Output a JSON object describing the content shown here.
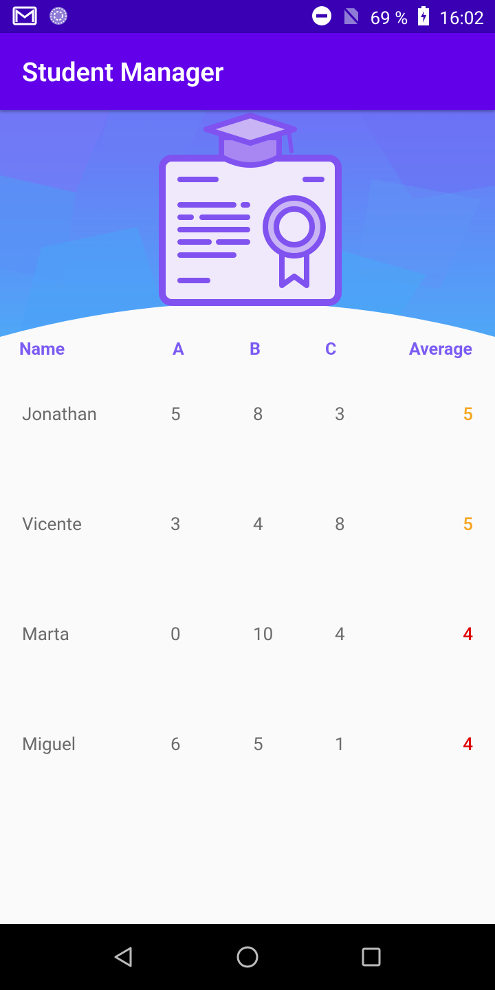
{
  "status_bar": {
    "battery": "69 %",
    "time": "16:02",
    "icons": [
      "gmail-icon",
      "sync-icon",
      "dnd-icon",
      "no-sim-icon",
      "battery-charging-icon"
    ]
  },
  "app_bar": {
    "title": "Student Manager"
  },
  "table": {
    "headers": {
      "name": "Name",
      "a": "A",
      "b": "B",
      "c": "C",
      "average": "Average"
    },
    "rows": [
      {
        "name": "Jonathan",
        "a": "5",
        "b": "8",
        "c": "3",
        "average": "5",
        "average_color": "#f5a623"
      },
      {
        "name": "Vicente",
        "a": "3",
        "b": "4",
        "c": "8",
        "average": "5",
        "average_color": "#f5a623"
      },
      {
        "name": "Marta",
        "a": "0",
        "b": "10",
        "c": "4",
        "average": "4",
        "average_color": "#e00000"
      },
      {
        "name": "Miguel",
        "a": "6",
        "b": "5",
        "c": "1",
        "average": "4",
        "average_color": "#e00000"
      }
    ]
  },
  "colors": {
    "accent": "#6200ea",
    "header_text": "#7c5cf2",
    "status_bar": "#3a00b4"
  },
  "nav_bar": {
    "icons": [
      "back-icon",
      "home-icon",
      "recents-icon"
    ]
  }
}
